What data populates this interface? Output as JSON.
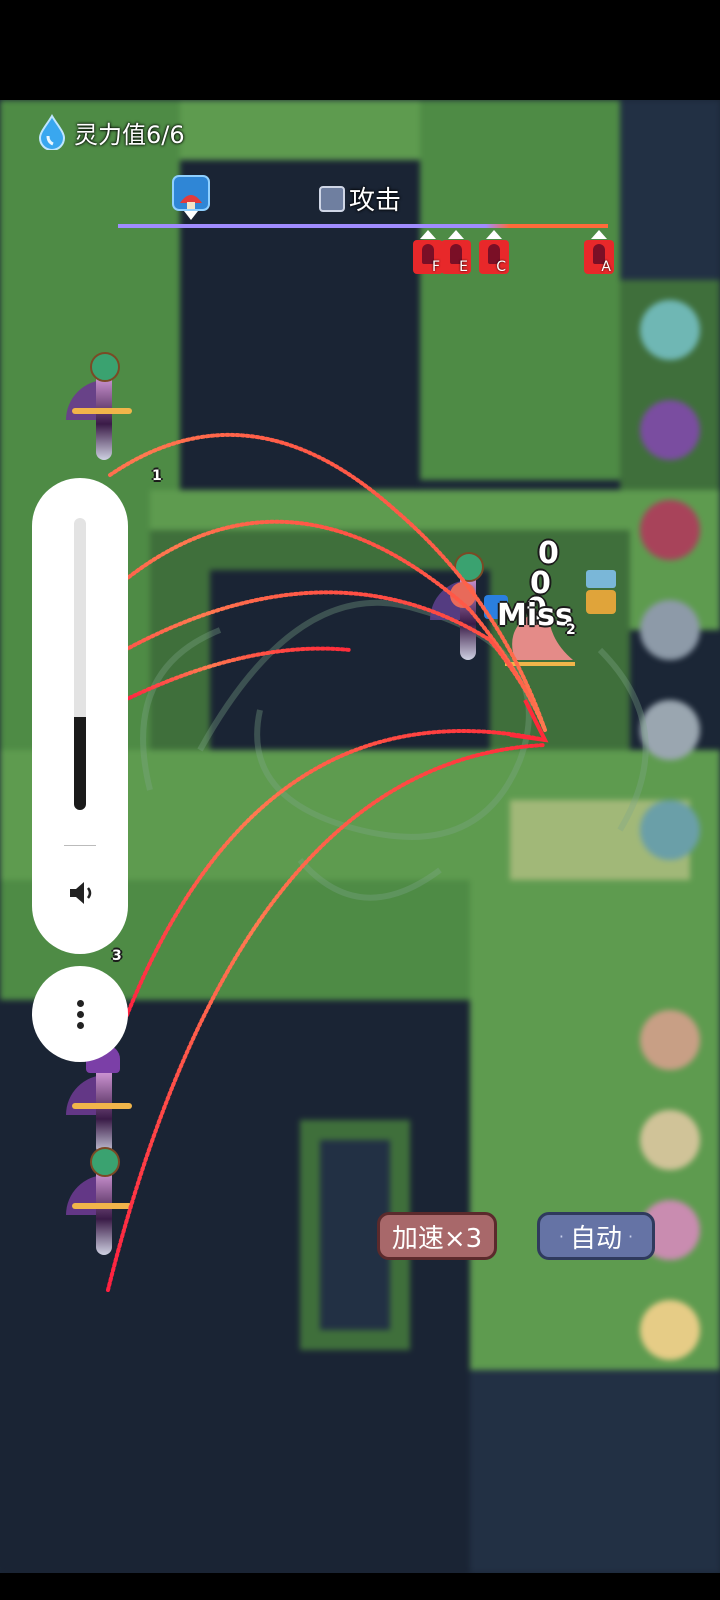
{
  "hud": {
    "spirit_label": "灵力值6/6",
    "attack_label": "攻击"
  },
  "timeline": {
    "enemies": [
      {
        "letter": "F"
      },
      {
        "letter": "E"
      },
      {
        "letter": "C"
      },
      {
        "letter": "A"
      }
    ]
  },
  "battle": {
    "damage_numbers": [
      "0",
      "0",
      "0"
    ],
    "miss_text": "Miss",
    "hero_level_numbers": [
      "1",
      "3",
      "2"
    ]
  },
  "controls": {
    "speed_label": "加速×3",
    "auto_label": "自动",
    "auto_prefix": "·",
    "auto_suffix": "·"
  },
  "volume_panel": {
    "level": 0.32
  },
  "colors": {
    "enemy_tag": "#e8282a",
    "speed_button": "#a8686a",
    "auto_button": "#6573a5",
    "timeline_player": "#a08cff",
    "timeline_enemy": "#ff6a3a"
  }
}
